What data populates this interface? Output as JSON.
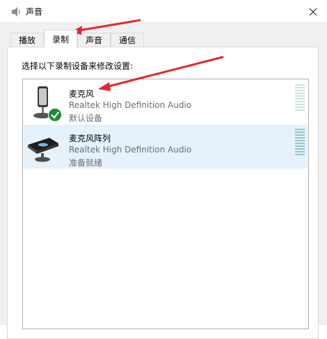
{
  "window": {
    "title": "声音",
    "close_glyph": "×"
  },
  "tabs": [
    {
      "label": "播放"
    },
    {
      "label": "录制"
    },
    {
      "label": "声音"
    },
    {
      "label": "通信"
    }
  ],
  "active_tab": "录制",
  "prompt": "选择以下录制设备来修改设置:",
  "devices": [
    {
      "name": "麦克风",
      "driver": "Realtek High Definition Audio",
      "status": "默认设备",
      "icon": "microphone-icon",
      "badge": "default-check-icon"
    },
    {
      "name": "麦克风阵列",
      "driver": "Realtek High Definition Audio",
      "status": "准备就绪",
      "icon": "microphone-array-icon",
      "selected": true
    }
  ],
  "colors": {
    "selected_row": "#e5f1fb",
    "arrow": "#e8262c",
    "check_badge": "#1f8a3b",
    "meter": "#8ec9c7"
  },
  "annotations": [
    {
      "type": "arrow",
      "target": "tab-recording"
    },
    {
      "type": "arrow",
      "target": "device-name-microphone"
    }
  ]
}
